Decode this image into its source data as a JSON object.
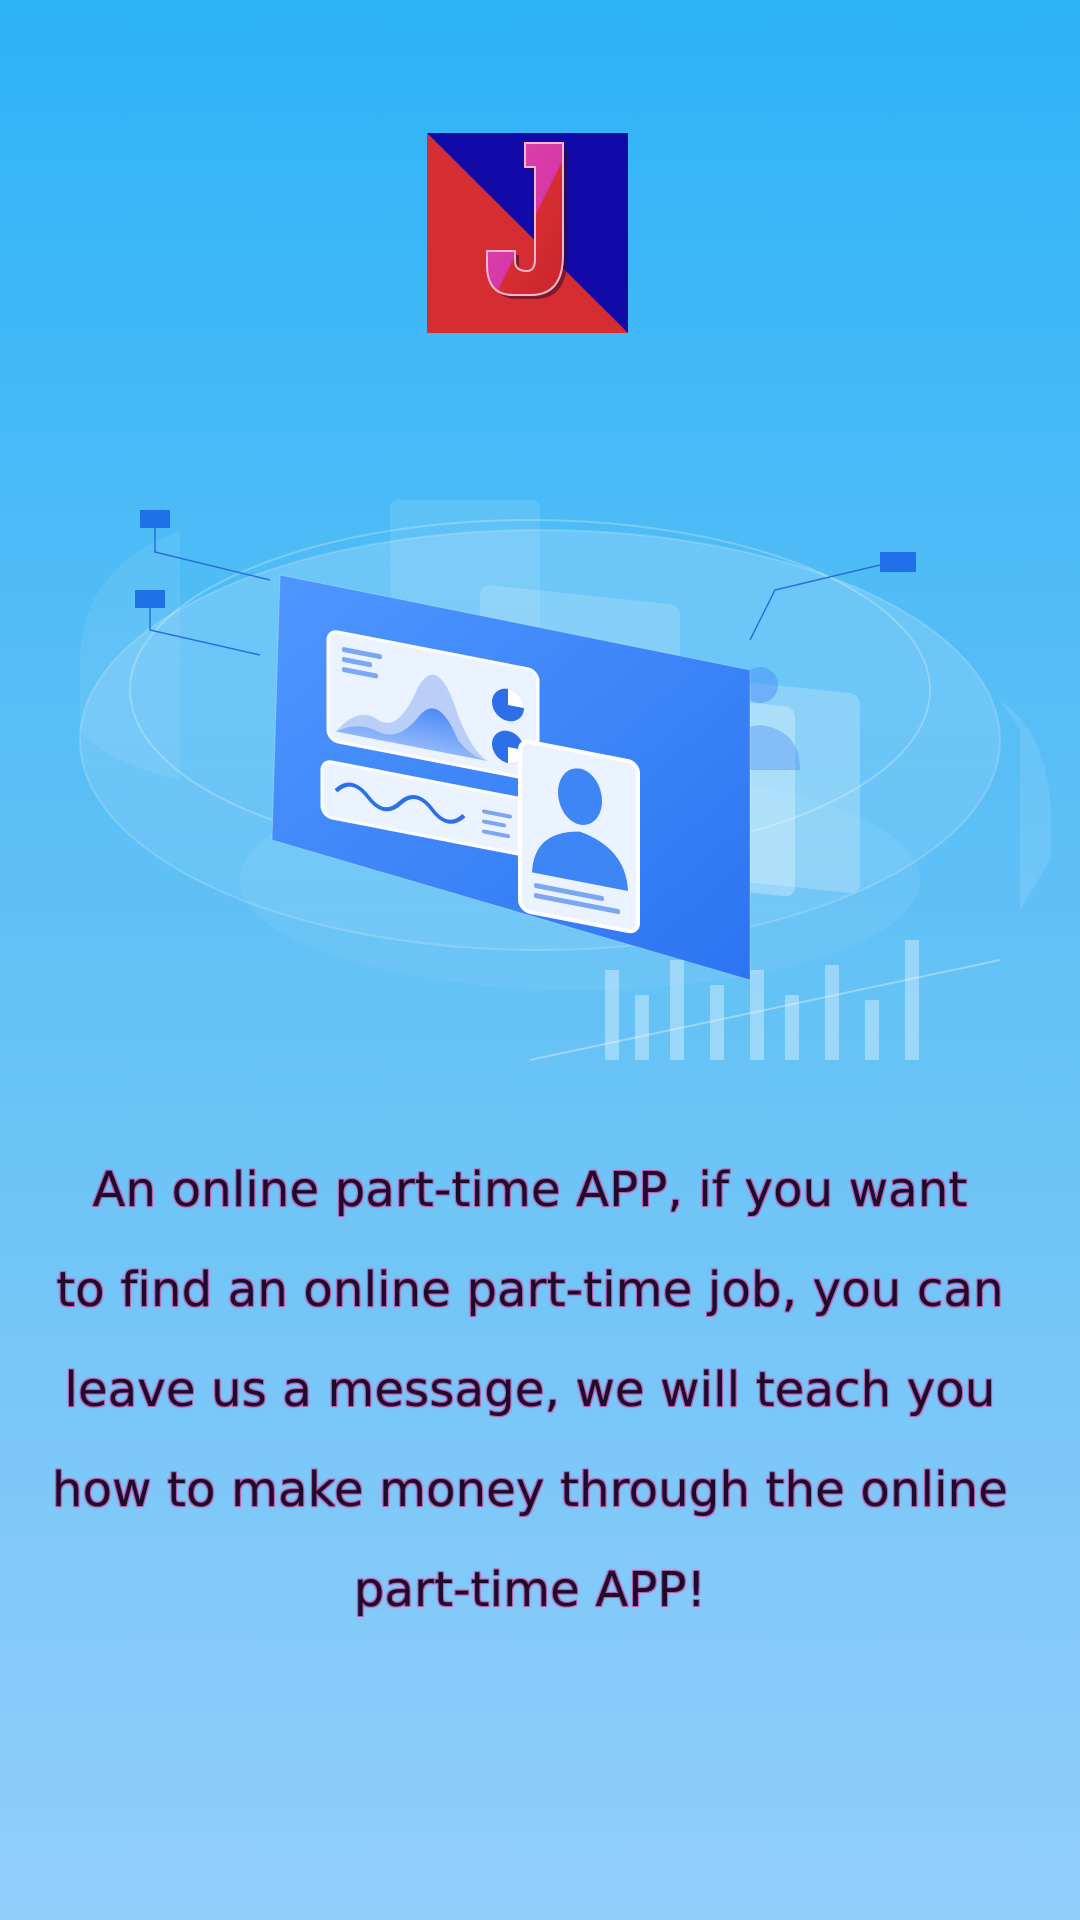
{
  "app": {
    "logo": {
      "letter": "J",
      "icon": "app-logo-icon",
      "colors": {
        "red": "#d62d33",
        "blue": "#1109a8",
        "magenta": "#d63aa6"
      }
    },
    "hero_icon": "dashboard-illustration-icon",
    "message": {
      "lines": [
        "An online part-time APP, if you want",
        "to find an online part-time job, you can",
        "leave us a message, we will teach you",
        "how to make money through the online",
        "part-time APP!"
      ]
    },
    "colors": {
      "background_top": "#2db3f8",
      "background_bottom": "#93cefb",
      "text": "#1d0b2a",
      "text_outline": "#b85fb2"
    }
  }
}
